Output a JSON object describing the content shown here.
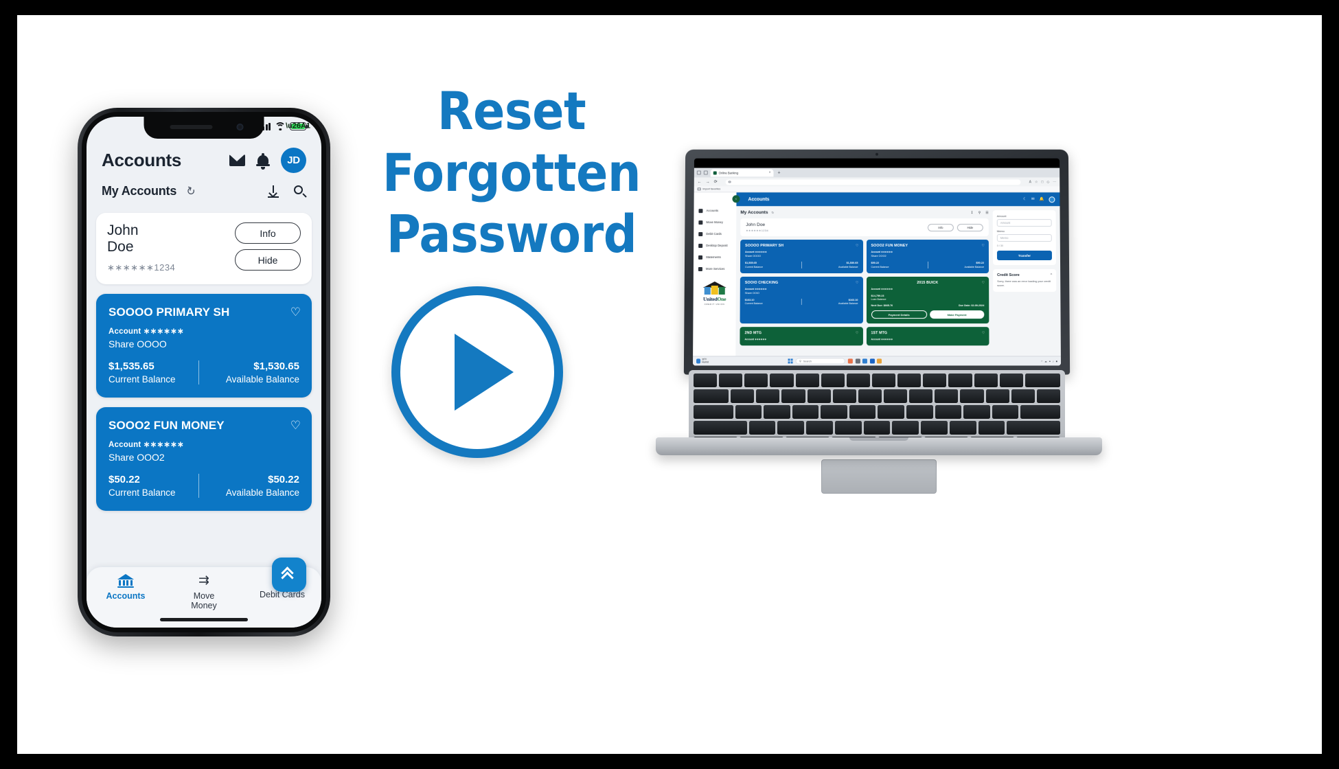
{
  "title": {
    "line1": "Reset",
    "line2": "Forgotten",
    "line3": "Password",
    "color": "#1479c0"
  },
  "play_button": {
    "name": "play-button"
  },
  "phone": {
    "status": {
      "carrier_bars": 4,
      "wifi": "wifi-icon",
      "battery": "battery-charging-icon"
    },
    "header": {
      "title": "Accounts",
      "mail_icon": "mail-icon",
      "bell_icon": "bell-icon",
      "avatar_initials": "JD"
    },
    "subheader": {
      "title": "My Accounts",
      "refresh_icon": "refresh-icon",
      "download_icon": "download-icon",
      "search_icon": "search-icon"
    },
    "user_card": {
      "name_line1": "John",
      "name_line2": "Doe",
      "masked_number": "∗∗∗∗∗∗1234",
      "info_label": "Info",
      "hide_label": "Hide"
    },
    "accounts": [
      {
        "name": "SOOOO PRIMARY SH",
        "account_label": "Account ∗∗∗∗∗∗",
        "share": "Share OOOO",
        "current_balance": "$1,535.65",
        "current_label": "Current Balance",
        "available_balance": "$1,530.65",
        "available_label": "Available Balance",
        "color": "#0b76c4"
      },
      {
        "name": "SOOO2 FUN MONEY",
        "account_label": "Account ∗∗∗∗∗∗",
        "share": "Share OOO2",
        "current_balance": "$50.22",
        "current_label": "Current Balance",
        "available_balance": "$50.22",
        "available_label": "Available Balance",
        "color": "#0b76c4"
      }
    ],
    "tabs": [
      {
        "label": "Accounts",
        "icon": "bank-icon",
        "active": true
      },
      {
        "label": "Move\nMoney",
        "label_l1": "Move",
        "label_l2": "Money",
        "icon": "transfer-icon",
        "active": false
      },
      {
        "label": "Debit Cards",
        "icon": "credit-card-icon",
        "active": false
      }
    ],
    "fab": {
      "icon": "double-chevron-up-icon"
    }
  },
  "laptop": {
    "browser": {
      "tab_title": "Online Banking",
      "tab_close": "×",
      "new_tab": "+",
      "back": "←",
      "forward": "→",
      "reload": "⟳",
      "bookmark_label": "Import favorites"
    },
    "topbar": {
      "title": "Accounts",
      "collapse_icon": "collapse-icon",
      "moon_icon": "dark-mode-icon",
      "mail_icon": "mail-icon",
      "bell_icon": "bell-icon",
      "avatar_icon": "avatar-icon"
    },
    "sidebar": {
      "items": [
        {
          "label": "Accounts",
          "icon": "accounts-icon"
        },
        {
          "label": "Move Money",
          "icon": "move-money-icon"
        },
        {
          "label": "Debit Cards",
          "icon": "debit-cards-icon"
        },
        {
          "label": "Desktop Deposit",
          "icon": "desktop-deposit-icon"
        },
        {
          "label": "Statements",
          "icon": "statements-icon"
        },
        {
          "label": "More Services",
          "icon": "more-services-icon"
        }
      ],
      "logo": {
        "name_part1": "United",
        "name_part2": "One",
        "tagline": "CREDIT UNION"
      }
    },
    "main": {
      "section_title": "My Accounts",
      "refresh_icon": "refresh-icon",
      "download_icon": "download-icon",
      "search_icon": "search-icon",
      "filter_icon": "filter-icon",
      "user": {
        "name": "John Doe",
        "masked_number": "∗∗∗∗∗∗1234",
        "info_label": "Info",
        "hide_label": "Hide"
      },
      "cards": [
        {
          "name": "SOOOO PRIMARY SH",
          "account_label": "Account ∗∗∗∗∗∗",
          "share": "Share OOOO",
          "current_balance": "$1,535.65",
          "current_label": "Current Balance",
          "available_balance": "$1,530.65",
          "available_label": "Available Balance",
          "type": "blue"
        },
        {
          "name": "SOOO2 FUN MONEY",
          "account_label": "Account ∗∗∗∗∗∗",
          "share": "Share OOO2",
          "current_balance": "$50.22",
          "current_label": "Current Balance",
          "available_balance": "$50.22",
          "available_label": "Available Balance",
          "type": "blue"
        },
        {
          "name": "SOOIO CHECKING",
          "account_label": "Account ∗∗∗∗∗∗",
          "share": "Share OOIO",
          "current_balance": "$163.10",
          "current_label": "Current Balance",
          "available_balance": "$163.10",
          "available_label": "Available Balance",
          "type": "blue"
        },
        {
          "name": "2015 BUICK",
          "account_label": "Account ∗∗∗∗∗∗",
          "loan_balance": "$14,759.23",
          "loan_label": "Loan Balance",
          "next_due": "Next Due: $665.76",
          "due_date": "Due Date: 02-09-2024",
          "payment_details_label": "Payment Details",
          "make_payment_label": "Make Payment",
          "type": "green"
        },
        {
          "name": "2ND MTG",
          "account_label": "Account ∗∗∗∗∗∗",
          "type": "green"
        },
        {
          "name": "1ST MTG",
          "account_label": "Account ∗∗∗∗∗∗",
          "type": "green"
        }
      ]
    },
    "right_panel": {
      "amount_label": "Amount",
      "amount_placeholder": "Amount",
      "memo_label": "Memo",
      "memo_placeholder": "Memo",
      "memo_counter": "0 / 30",
      "transfer_label": "Transfer",
      "credit_score_title": "Credit Score",
      "credit_score_message": "Sorry, there was an error loading your credit score.",
      "collapse_icon": "chevron-up-icon"
    },
    "taskbar": {
      "weather_temp": "39°F",
      "weather_desc": "Humid",
      "start_icon": "windows-start-icon",
      "search_placeholder": "Search",
      "search_icon": "search-icon"
    }
  }
}
